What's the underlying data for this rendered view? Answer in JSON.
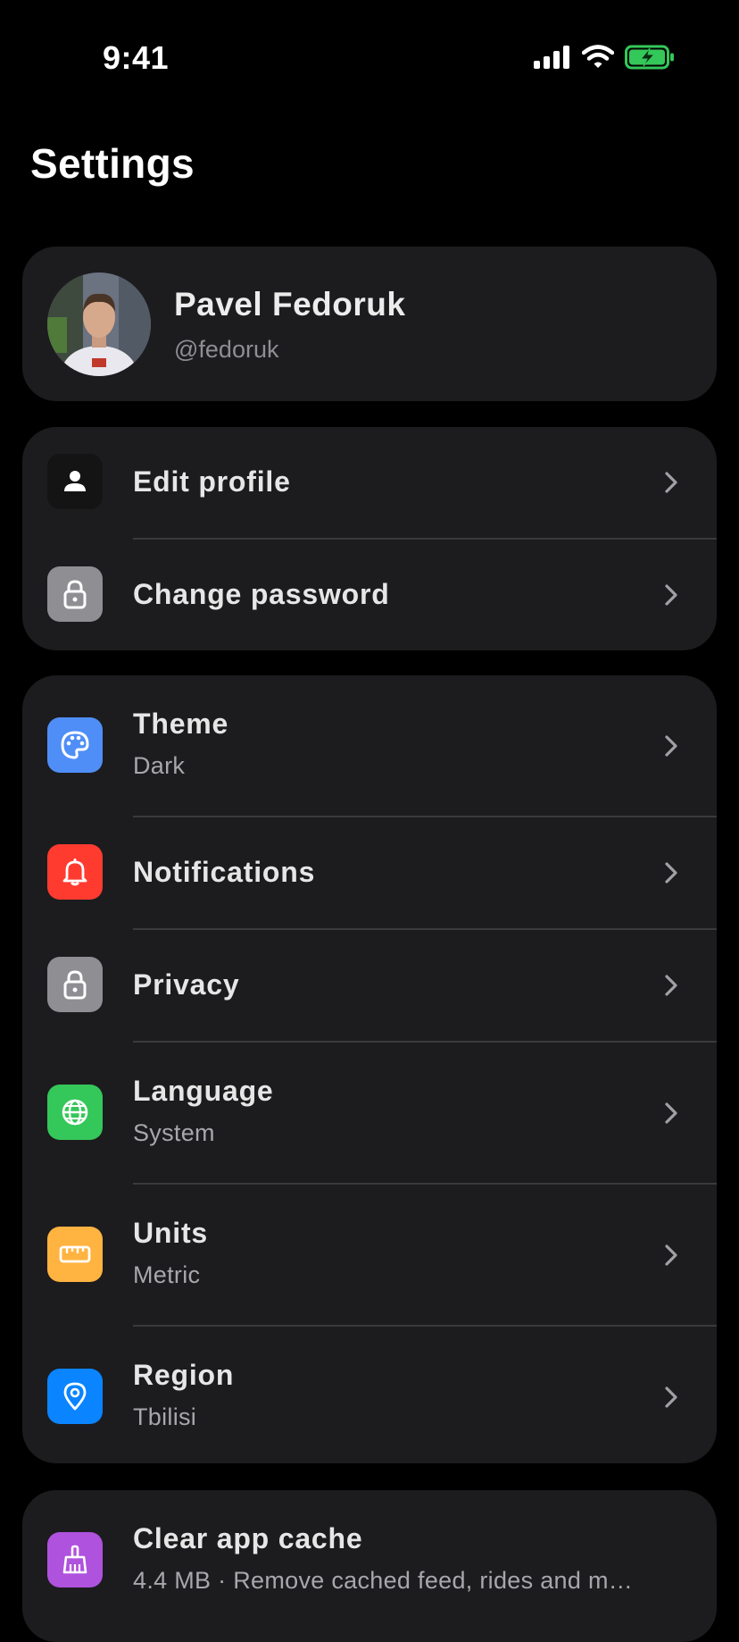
{
  "status_bar": {
    "time": "9:41"
  },
  "page": {
    "title": "Settings"
  },
  "profile": {
    "name": "Pavel Fedoruk",
    "handle": "@fedoruk"
  },
  "account_group": {
    "items": [
      {
        "label": "Edit profile",
        "icon": "person-icon",
        "icon_color": "#141414"
      },
      {
        "label": "Change password",
        "icon": "lock-icon",
        "icon_color": "#8e8e93"
      }
    ]
  },
  "preferences_group": {
    "items": [
      {
        "label": "Theme",
        "value": "Dark",
        "icon": "palette-icon",
        "icon_color": "#4f8ef7"
      },
      {
        "label": "Notifications",
        "icon": "bell-icon",
        "icon_color": "#ff3b30"
      },
      {
        "label": "Privacy",
        "icon": "lock-icon",
        "icon_color": "#8e8e93"
      },
      {
        "label": "Language",
        "value": "System",
        "icon": "globe-icon",
        "icon_color": "#34c759"
      },
      {
        "label": "Units",
        "value": "Metric",
        "icon": "ruler-icon",
        "icon_color": "#ffb340"
      },
      {
        "label": "Region",
        "value": "Tbilisi",
        "icon": "location-pin-icon",
        "icon_color": "#0a84ff"
      }
    ]
  },
  "storage_group": {
    "items": [
      {
        "label": "Clear app cache",
        "value": "4.4 MB · Remove cached feed, rides and m…",
        "icon": "broom-icon",
        "icon_color": "#af52de"
      }
    ]
  }
}
